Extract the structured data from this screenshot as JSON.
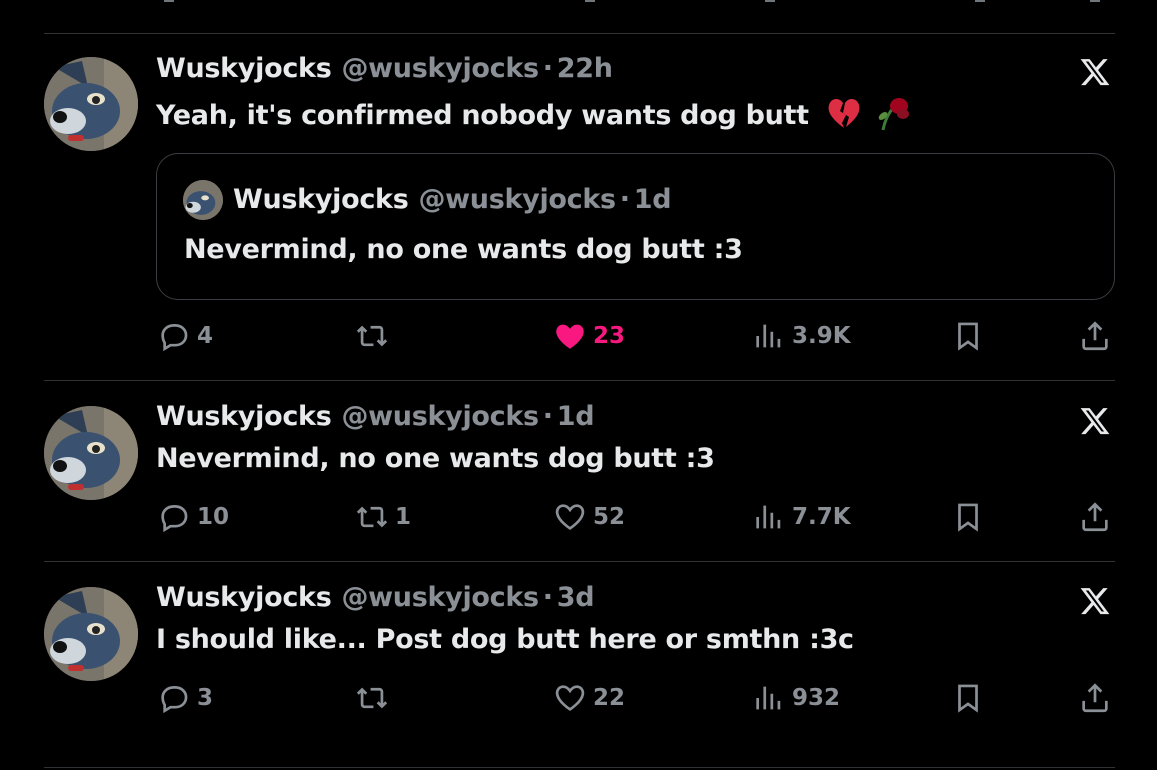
{
  "colors": {
    "background": "#000000",
    "text": "#e7e9ea",
    "muted": "#8b9096",
    "divider": "#2f3336",
    "like_active": "#f91880"
  },
  "tweets": [
    {
      "name": "Wuskyjocks",
      "handle": "@wuskyjocks",
      "separator": "·",
      "time": "22h",
      "text": "Yeah, it's confirmed nobody wants dog butt",
      "emojis": [
        "broken-heart-emoji",
        "wilted-flower-emoji"
      ],
      "quote": {
        "name": "Wuskyjocks",
        "handle": "@wuskyjocks",
        "separator": "·",
        "time": "1d",
        "text": "Nevermind, no one wants dog butt :3"
      },
      "actions": {
        "replies": "4",
        "reposts": "",
        "likes": "23",
        "liked": true,
        "views": "3.9K"
      }
    },
    {
      "name": "Wuskyjocks",
      "handle": "@wuskyjocks",
      "separator": "·",
      "time": "1d",
      "text": "Nevermind, no one wants dog butt :3",
      "actions": {
        "replies": "10",
        "reposts": "1",
        "likes": "52",
        "liked": false,
        "views": "7.7K"
      }
    },
    {
      "name": "Wuskyjocks",
      "handle": "@wuskyjocks",
      "separator": "·",
      "time": "3d",
      "text": "I should like... Post dog butt here or smthn :3c",
      "actions": {
        "replies": "3",
        "reposts": "",
        "likes": "22",
        "liked": false,
        "views": "932"
      }
    }
  ],
  "icons": {
    "reply": "reply-bubble-icon",
    "repost": "repost-icon",
    "like": "heart-icon",
    "views": "views-bars-icon",
    "bookmark": "bookmark-icon",
    "share": "share-icon",
    "brand": "x-logo-icon"
  }
}
